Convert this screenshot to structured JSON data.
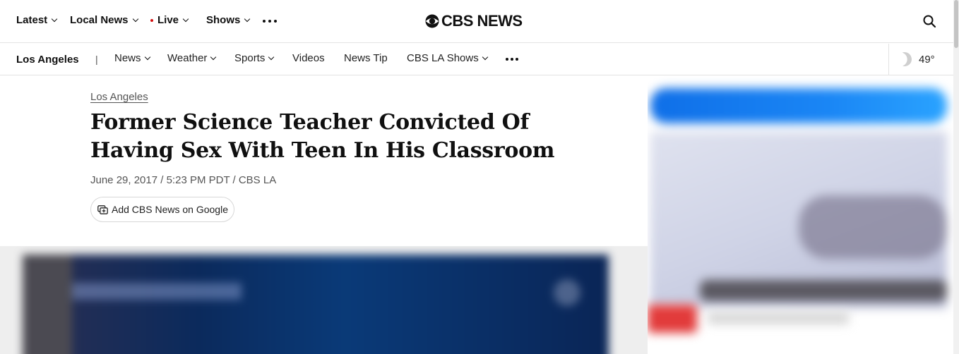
{
  "top_nav": {
    "latest": "Latest",
    "local_news": "Local News",
    "live": "Live",
    "shows": "Shows",
    "logo_text": "CBS NEWS"
  },
  "sub_nav": {
    "city": "Los Angeles",
    "separator": "|",
    "items": [
      "News",
      "Weather",
      "Sports",
      "Videos",
      "News Tip",
      "CBS LA Shows"
    ],
    "weather_temp": "49°"
  },
  "article": {
    "kicker": "Los Angeles",
    "headline": "Former Science Teacher Convicted Of Having Sex With Teen In His Classroom",
    "byline": "June 29, 2017 / 5:23 PM PDT / CBS LA",
    "google_button": "Add CBS News on Google"
  },
  "colors": {
    "live_dot": "#d40f0f",
    "text": "#101010",
    "muted": "#555555"
  }
}
